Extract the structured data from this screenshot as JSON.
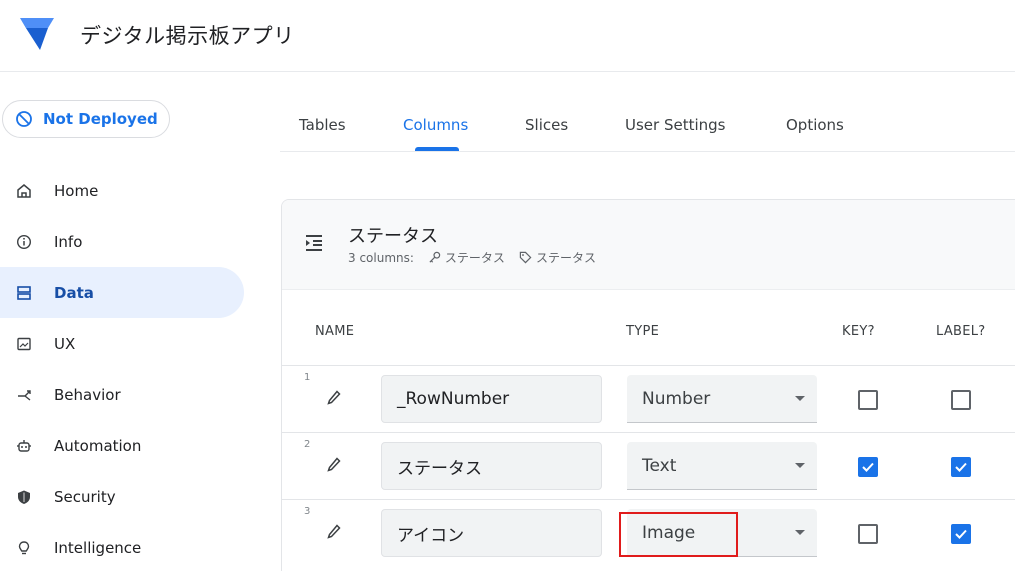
{
  "app": {
    "title": "デジタル掲示板アプリ",
    "logo": "appsheet-logo-icon",
    "brand_color": "#1a73e8"
  },
  "deploy": {
    "label": "Not Deployed",
    "icon": "not-deployed-icon"
  },
  "sidebar": {
    "items": [
      {
        "label": "Home",
        "icon": "home-icon",
        "active": false
      },
      {
        "label": "Info",
        "icon": "info-icon",
        "active": false
      },
      {
        "label": "Data",
        "icon": "data-icon",
        "active": true
      },
      {
        "label": "UX",
        "icon": "ux-icon",
        "active": false
      },
      {
        "label": "Behavior",
        "icon": "behavior-icon",
        "active": false
      },
      {
        "label": "Automation",
        "icon": "automation-icon",
        "active": false
      },
      {
        "label": "Security",
        "icon": "shield-icon",
        "active": false
      },
      {
        "label": "Intelligence",
        "icon": "lightbulb-icon",
        "active": false
      }
    ]
  },
  "tabs": [
    {
      "label": "Tables",
      "active": false
    },
    {
      "label": "Columns",
      "active": true
    },
    {
      "label": "Slices",
      "active": false
    },
    {
      "label": "User Settings",
      "active": false
    },
    {
      "label": "Options",
      "active": false
    }
  ],
  "table": {
    "title": "ステータス",
    "columns_count": "3 columns:",
    "key_meta": "ステータス",
    "label_meta": "ステータス",
    "headers": {
      "name": "NAME",
      "type": "TYPE",
      "key": "KEY?",
      "label": "LABEL?"
    },
    "rows": [
      {
        "num": "1",
        "name": "_RowNumber",
        "type": "Number",
        "key": false,
        "label": false
      },
      {
        "num": "2",
        "name": "ステータス",
        "type": "Text",
        "key": true,
        "label": true
      },
      {
        "num": "3",
        "name": "アイコン",
        "type": "Image",
        "key": false,
        "label": true,
        "highlighted": true
      }
    ]
  }
}
